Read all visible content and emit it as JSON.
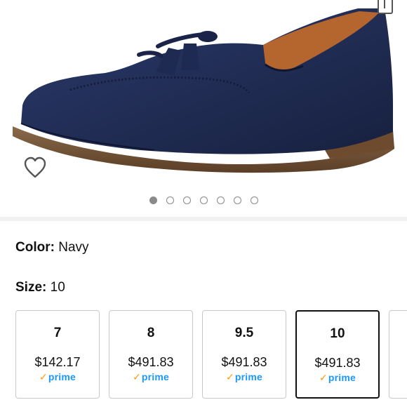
{
  "product": {
    "image_alt": "navy suede tassel loafer",
    "carousel": {
      "count": 7,
      "active_index": 0
    }
  },
  "colors": {
    "accent": "#ff9900",
    "prime_blue": "#1a98ff",
    "shoe": "#1f2a4f"
  },
  "color_row": {
    "label": "Color:",
    "value": "Navy"
  },
  "size_row": {
    "label": "Size:",
    "value": "10"
  },
  "sizes": [
    {
      "size": "7",
      "price": "$142.17",
      "prime_check": "✓",
      "prime_label": "prime",
      "selected": false
    },
    {
      "size": "8",
      "price": "$491.83",
      "prime_check": "✓",
      "prime_label": "prime",
      "selected": false
    },
    {
      "size": "9.5",
      "price": "$491.83",
      "prime_check": "✓",
      "prime_label": "prime",
      "selected": false
    },
    {
      "size": "10",
      "price": "$491.83",
      "prime_check": "✓",
      "prime_label": "prime",
      "selected": true
    }
  ]
}
